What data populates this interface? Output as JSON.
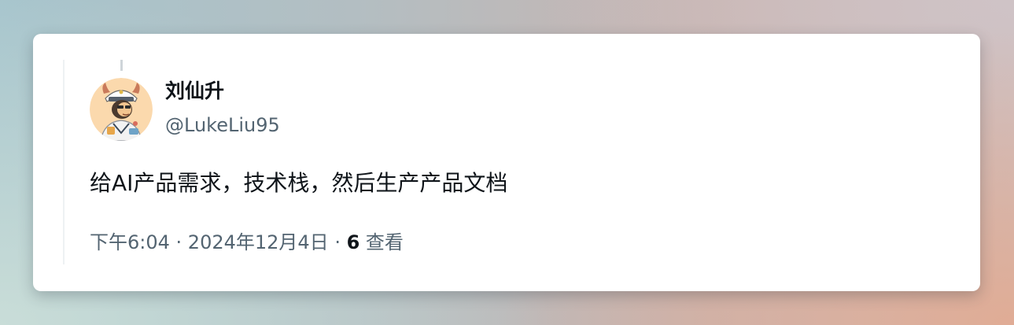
{
  "tweet": {
    "author": {
      "display_name": "刘仙升",
      "handle": "@LukeLiu95",
      "avatar_icon": "cartoon-sailor-avatar"
    },
    "text": "给AI产品需求，技术栈，然后生产产品文档",
    "meta": {
      "time": "下午6:04",
      "separator": " · ",
      "date": "2024年12月4日",
      "views_count": "6",
      "views_label": " 查看"
    }
  },
  "colors": {
    "primary_text": "#0f1419",
    "secondary_text": "#536471",
    "card_background": "#ffffff"
  }
}
